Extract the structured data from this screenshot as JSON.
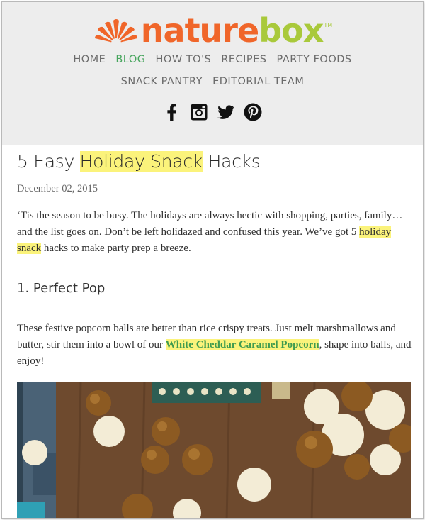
{
  "brand": {
    "part1": "nature",
    "part2": "box",
    "tm": "TM"
  },
  "nav": {
    "row1": [
      "HOME",
      "BLOG",
      "HOW TO'S",
      "RECIPES",
      "PARTY FOODS"
    ],
    "row2": [
      "SNACK PANTRY",
      "EDITORIAL TEAM"
    ],
    "active": "BLOG"
  },
  "social": [
    "facebook-icon",
    "instagram-icon",
    "twitter-icon",
    "pinterest-icon"
  ],
  "article": {
    "title_pre": "5 Easy ",
    "title_hl": "Holiday Snack",
    "title_post": " Hacks",
    "date": "December 02, 2015",
    "p1_pre": "‘Tis the season to be busy. The holidays are always hectic with shopping, parties, family…and the list goes on. Don’t be left holidazed and confused this year. We’ve got 5 ",
    "p1_hl": "holiday snack",
    "p1_post": " hacks to make party prep a breeze.",
    "subhead": "1. Perfect Pop",
    "p2_pre": "These festive popcorn balls are better than rice crispy treats. Just melt marshmallows and butter, stir them into a bowl of our ",
    "p2_link": "White Cheddar Caramel Popcorn",
    "p2_post": ", shape into balls, and enjoy!"
  },
  "colors": {
    "brand_orange": "#f0662a",
    "brand_green": "#a9c93b",
    "nav_active": "#47a55d",
    "highlight": "#fbf37b",
    "header_bg": "#ededed"
  }
}
